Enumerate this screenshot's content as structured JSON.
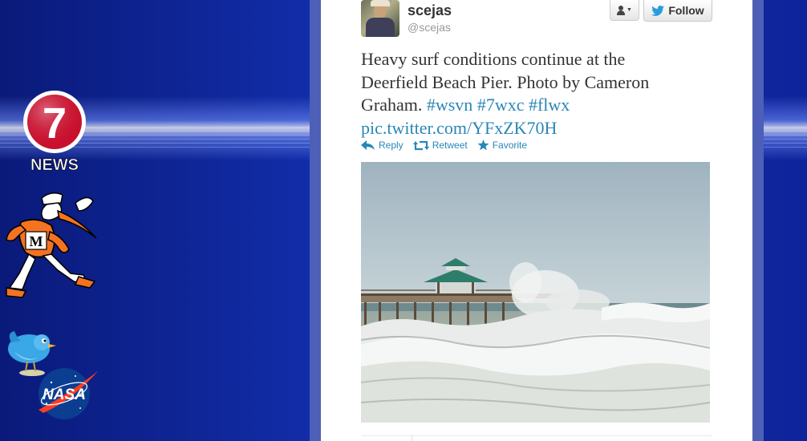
{
  "tweet": {
    "display_name": "scejas",
    "screen_name": "@scejas",
    "text_line1": "Heavy surf conditions continue at the",
    "text_line2": "Deerfield Beach Pier. Photo by Cameron",
    "text_line3_plain": "Graham.",
    "hashtags": [
      "#wsvn",
      "#7wxc",
      "#flwx"
    ],
    "pic_link": "pic.twitter.com/YFxZK70H"
  },
  "buttons": {
    "follow_label": "Follow"
  },
  "actions": {
    "reply_label": "Reply",
    "retweet_label": "Retweet",
    "favorite_label": "Favorite"
  },
  "background": {
    "news_label": "NEWS",
    "channel_number": "7",
    "nasa_label": "NASA"
  },
  "colors": {
    "link": "#2a86b7",
    "text": "#333333",
    "background_blue": "#0b1e8c",
    "twitter_blue": "#2a9ddb"
  },
  "icons": {
    "user_menu": "person-icon",
    "follow": "twitter-bird-icon",
    "reply": "reply-arrow-icon",
    "retweet": "retweet-icon",
    "favorite": "star-icon"
  }
}
